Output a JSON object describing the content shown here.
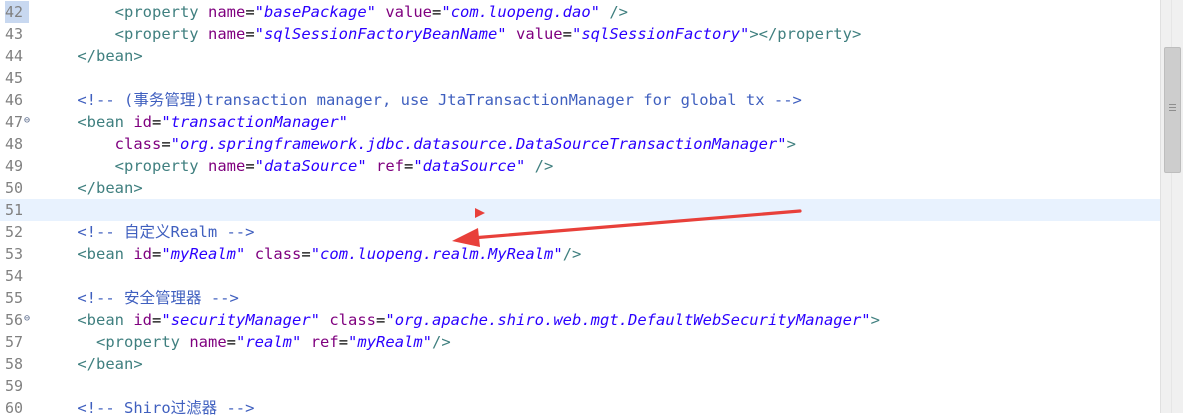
{
  "editor": {
    "lines": [
      {
        "num": "42",
        "tokens": [
          [
            "",
            "        "
          ],
          [
            "tag",
            "<property"
          ],
          [
            "",
            " "
          ],
          [
            "attr",
            "name"
          ],
          [
            "",
            "="
          ],
          [
            "str",
            "\"basePackage\""
          ],
          [
            "",
            " "
          ],
          [
            "attr",
            "value"
          ],
          [
            "",
            "="
          ],
          [
            "str",
            "\"com.luopeng.dao\""
          ],
          [
            "",
            " "
          ],
          [
            "tag",
            "/>"
          ]
        ]
      },
      {
        "num": "43",
        "tokens": [
          [
            "",
            "        "
          ],
          [
            "tag",
            "<property"
          ],
          [
            "",
            " "
          ],
          [
            "attr",
            "name"
          ],
          [
            "",
            "="
          ],
          [
            "str",
            "\"sqlSessionFactoryBeanName\""
          ],
          [
            "",
            " "
          ],
          [
            "attr",
            "value"
          ],
          [
            "",
            "="
          ],
          [
            "str",
            "\"sqlSessionFactory\""
          ],
          [
            "tag",
            "></property>"
          ]
        ]
      },
      {
        "num": "44",
        "tokens": [
          [
            "",
            "    "
          ],
          [
            "tag",
            "</bean>"
          ]
        ]
      },
      {
        "num": "45",
        "tokens": []
      },
      {
        "num": "46",
        "tokens": [
          [
            "",
            "    "
          ],
          [
            "cmt",
            "<!-- (事务管理)transaction manager, use JtaTransactionManager for global tx -->"
          ]
        ]
      },
      {
        "num": "47",
        "fold": true,
        "tokens": [
          [
            "",
            "    "
          ],
          [
            "tag",
            "<bean"
          ],
          [
            "",
            " "
          ],
          [
            "attr",
            "id"
          ],
          [
            "",
            "="
          ],
          [
            "str",
            "\"transactionManager\""
          ]
        ]
      },
      {
        "num": "48",
        "tokens": [
          [
            "",
            "        "
          ],
          [
            "attr",
            "class"
          ],
          [
            "",
            "="
          ],
          [
            "str",
            "\"org.springframework.jdbc.datasource.DataSourceTransactionManager\""
          ],
          [
            "tag",
            ">"
          ]
        ]
      },
      {
        "num": "49",
        "tokens": [
          [
            "",
            "        "
          ],
          [
            "tag",
            "<property"
          ],
          [
            "",
            " "
          ],
          [
            "attr",
            "name"
          ],
          [
            "",
            "="
          ],
          [
            "str",
            "\"dataSource\""
          ],
          [
            "",
            " "
          ],
          [
            "attr",
            "ref"
          ],
          [
            "",
            "="
          ],
          [
            "str",
            "\"dataSource\""
          ],
          [
            "",
            " "
          ],
          [
            "tag",
            "/>"
          ]
        ]
      },
      {
        "num": "50",
        "tokens": [
          [
            "",
            "    "
          ],
          [
            "tag",
            "</bean>"
          ]
        ]
      },
      {
        "num": "51",
        "current": true,
        "tokens": []
      },
      {
        "num": "52",
        "tokens": [
          [
            "",
            "    "
          ],
          [
            "cmt",
            "<!-- 自定义Realm -->"
          ]
        ]
      },
      {
        "num": "53",
        "tokens": [
          [
            "",
            "    "
          ],
          [
            "tag",
            "<bean"
          ],
          [
            "",
            " "
          ],
          [
            "attr",
            "id"
          ],
          [
            "",
            "="
          ],
          [
            "str",
            "\"myRealm\""
          ],
          [
            "",
            " "
          ],
          [
            "attr",
            "class"
          ],
          [
            "",
            "="
          ],
          [
            "str",
            "\"com.luopeng.realm.MyRealm\""
          ],
          [
            "tag",
            "/>"
          ]
        ]
      },
      {
        "num": "54",
        "tokens": []
      },
      {
        "num": "55",
        "tokens": [
          [
            "",
            "    "
          ],
          [
            "cmt",
            "<!-- 安全管理器 -->"
          ]
        ]
      },
      {
        "num": "56",
        "fold": true,
        "tokens": [
          [
            "",
            "    "
          ],
          [
            "tag",
            "<bean"
          ],
          [
            "",
            " "
          ],
          [
            "attr",
            "id"
          ],
          [
            "",
            "="
          ],
          [
            "str",
            "\"securityManager\""
          ],
          [
            "",
            " "
          ],
          [
            "attr",
            "class"
          ],
          [
            "",
            "="
          ],
          [
            "str",
            "\"org.apache.shiro.web.mgt.DefaultWebSecurityManager\""
          ],
          [
            "tag",
            ">"
          ]
        ]
      },
      {
        "num": "57",
        "tokens": [
          [
            "",
            "      "
          ],
          [
            "tag",
            "<property"
          ],
          [
            "",
            " "
          ],
          [
            "attr",
            "name"
          ],
          [
            "",
            "="
          ],
          [
            "str",
            "\"realm\""
          ],
          [
            "",
            " "
          ],
          [
            "attr",
            "ref"
          ],
          [
            "",
            "="
          ],
          [
            "str",
            "\"myRealm\""
          ],
          [
            "tag",
            "/>"
          ]
        ]
      },
      {
        "num": "58",
        "tokens": [
          [
            "",
            "    "
          ],
          [
            "tag",
            "</bean>"
          ]
        ]
      },
      {
        "num": "59",
        "tokens": []
      },
      {
        "num": "60",
        "tokens": [
          [
            "",
            "    "
          ],
          [
            "cmt",
            "<!-- Shiro过滤器 -->"
          ]
        ]
      }
    ]
  },
  "annotation": {
    "color": "#e8403a",
    "icon": "red-arrow-annotation"
  },
  "scrollbar": {
    "icon": "vertical-scrollbar"
  }
}
